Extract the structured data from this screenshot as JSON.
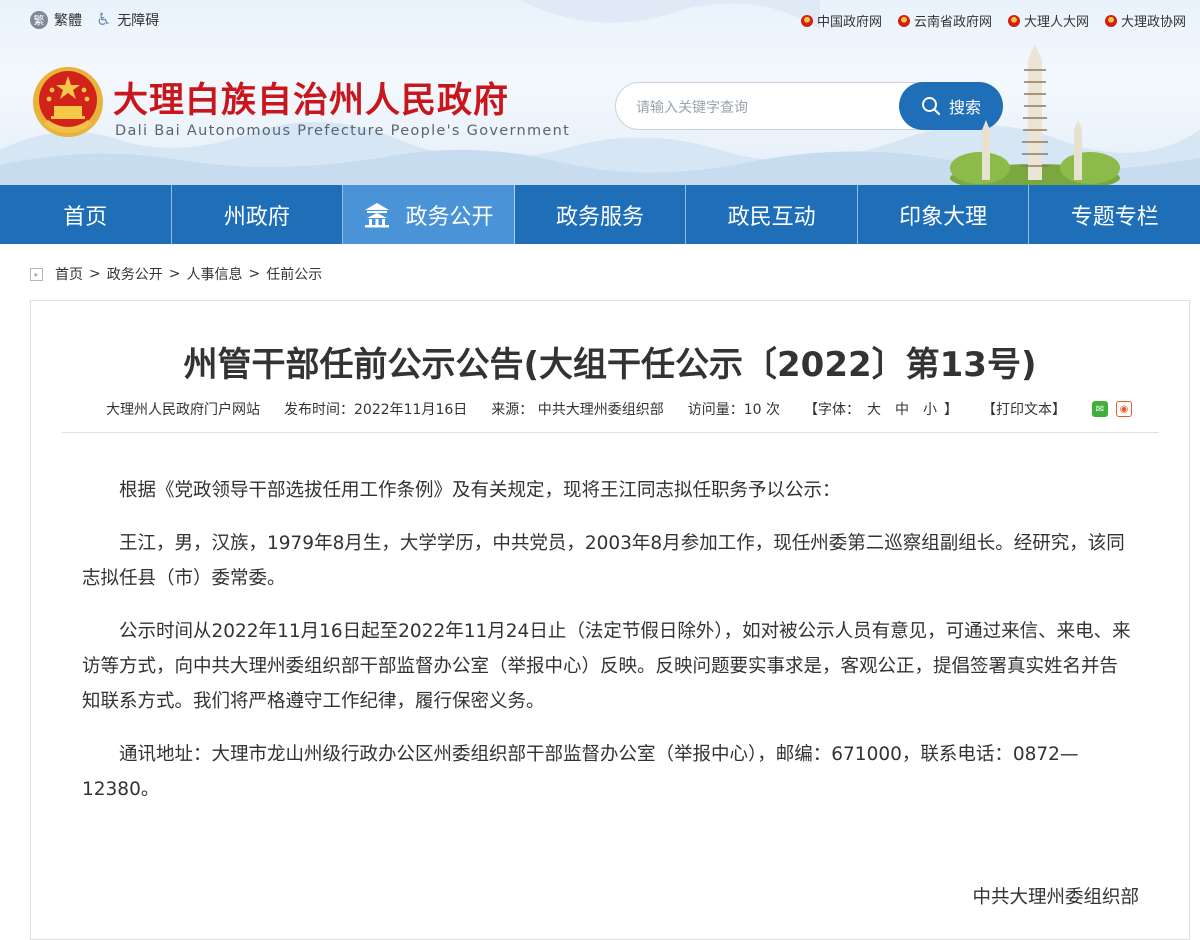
{
  "top_links": {
    "traditional": "繁體",
    "accessibility": "无障碍",
    "external": [
      "中国政府网",
      "云南省政府网",
      "大理人大网",
      "大理政协网"
    ]
  },
  "header": {
    "title": "大理白族自治州人民政府",
    "subtitle": "Dali Bai Autonomous Prefecture People's Government"
  },
  "search": {
    "placeholder": "请输入关键字查询",
    "button": "搜索"
  },
  "nav": {
    "items": [
      "首页",
      "州政府",
      "政务公开",
      "政务服务",
      "政民互动",
      "印象大理",
      "专题专栏"
    ]
  },
  "breadcrumb": [
    "首页",
    "政务公开",
    "人事信息",
    "任前公示"
  ],
  "article": {
    "title": "州管干部任前公示公告(大组干任公示〔2022〕第13号)",
    "meta": {
      "site": "大理州人民政府门户网站",
      "published": "发布时间：2022年11月16日",
      "source": "来源：  中共大理州委组织部",
      "visits": "访问量：10 次",
      "font_size_label": "【字体：",
      "font_sizes": [
        "大",
        "中",
        "小"
      ],
      "font_size_end": "】",
      "print": "【打印文本】"
    },
    "paragraphs": [
      "根据《党政领导干部选拔任用工作条例》及有关规定，现将王江同志拟任职务予以公示：",
      "王江，男，汉族，1979年8月生，大学学历，中共党员，2003年8月参加工作，现任州委第二巡察组副组长。经研究，该同志拟任县（市）委常委。",
      "公示时间从2022年11月16日起至2022年11月24日止（法定节假日除外），如对被公示人员有意见，可通过来信、来电、来访等方式，向中共大理州委组织部干部监督办公室（举报中心）反映。反映问题要实事求是，客观公正，提倡签署真实姓名并告知联系方式。我们将严格遵守工作纪律，履行保密义务。",
      "通讯地址：大理市龙山州级行政办公区州委组织部干部监督办公室（举报中心），邮编：671000，联系电话：0872—12380。"
    ],
    "signature": "中共大理州委组织部"
  },
  "colors": {
    "brand_blue": "#1f6eb8",
    "active_blue": "#4a93d6",
    "title_red": "#c8161d"
  },
  "icons": [
    "traditional-chinese-icon",
    "accessibility-icon",
    "national-emblem-icon",
    "search-icon",
    "temple-icon",
    "breadcrumb-icon",
    "wechat-icon",
    "weibo-icon"
  ]
}
